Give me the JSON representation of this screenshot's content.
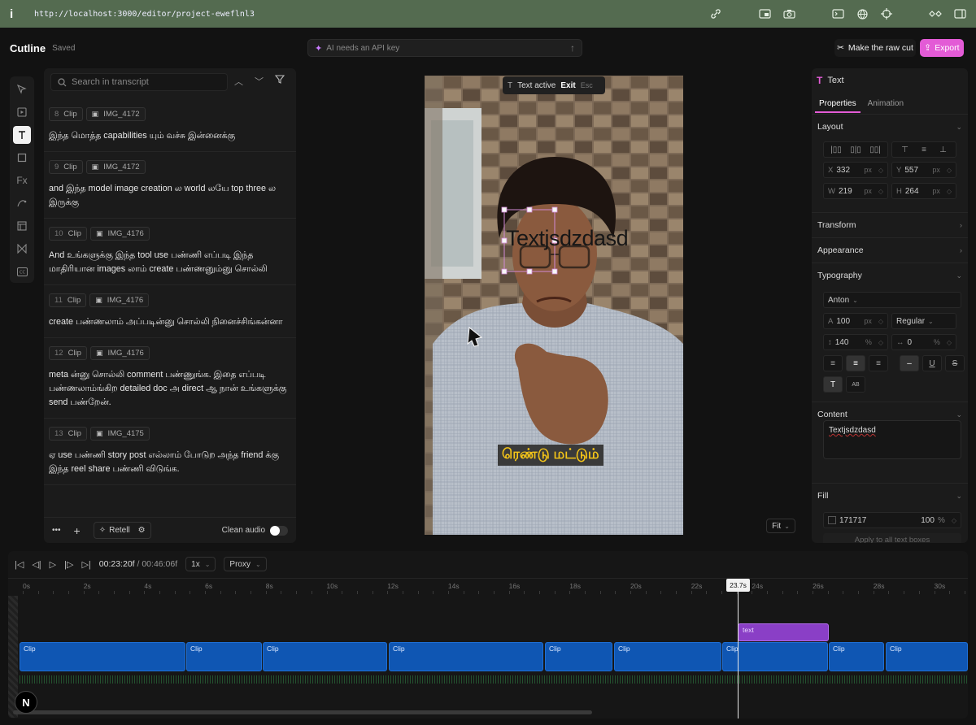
{
  "browser": {
    "url": "http://localhost:3000/editor/project-eweflnl3"
  },
  "app": {
    "name": "Cutline",
    "save_status": "Saved"
  },
  "ai_bar": {
    "placeholder": "AI needs an API key"
  },
  "header_actions": {
    "raw_cut_label": "Make the raw cut",
    "export_label": "Export"
  },
  "tools": [
    "select",
    "media",
    "text",
    "shape",
    "effects",
    "path",
    "layout",
    "transition",
    "captions"
  ],
  "transcript": {
    "search_placeholder": "Search in transcript",
    "segments": [
      {
        "index": "8",
        "type": "Clip",
        "source": "IMG_4172",
        "text": "இந்த மொத்த capabilities யும் வச்சு இன்னைக்கு"
      },
      {
        "index": "9",
        "type": "Clip",
        "source": "IMG_4172",
        "text": "and இந்த model image creation ல world லயே top three ல இருக்கு"
      },
      {
        "index": "10",
        "type": "Clip",
        "source": "IMG_4176",
        "text": "And உங்களுக்கு இந்த tool use பண்ணி எப்படி இந்த மாதிரியான images லாம் create பண்ணனும்னு சொல்லி"
      },
      {
        "index": "11",
        "type": "Clip",
        "source": "IMG_4176",
        "text": "create பண்ணலாம் அப்படின்னு சொல்லி நினைச்சிங்கன்னா"
      },
      {
        "index": "12",
        "type": "Clip",
        "source": "IMG_4176",
        "text": "meta ன்னு சொல்லி comment பண்ணுங்க. இதை எப்படி பண்ணலாம்ங்கிற detailed doc அ direct ஆ நான் உங்களுக்கு send பண்றேன்."
      },
      {
        "index": "13",
        "type": "Clip",
        "source": "IMG_4175",
        "text": "ஏ use பண்ணி story post எல்லாம் போடுற அந்த friend க்கு இந்த reel share பண்ணி விடுங்க."
      }
    ],
    "footer": {
      "retell_label": "Retell",
      "clean_audio_label": "Clean audio",
      "clean_audio_on": true
    }
  },
  "preview": {
    "text_active_label": "Text active",
    "exit_label": "Exit",
    "esc_label": "Esc",
    "overlay_text": "Textjsdzdasd",
    "caption": "ரெண்டு மட்டும்",
    "fit_label": "Fit"
  },
  "properties": {
    "title": "Text",
    "tabs": [
      "Properties",
      "Animation"
    ],
    "active_tab": "Properties",
    "layout_label": "Layout",
    "x": "332",
    "y": "557",
    "w": "219",
    "h": "264",
    "unit": "px",
    "transform_label": "Transform",
    "appearance_label": "Appearance",
    "typography_label": "Typography",
    "font": "Anton",
    "font_size": "100",
    "font_weight": "Regular",
    "line_height": "140",
    "letter_spacing": "0",
    "percent": "%",
    "content_label": "Content",
    "content_value": "Textjsdzdasd",
    "fill_label": "Fill",
    "fill_hex": "171717",
    "fill_opacity": "100",
    "apply_all_label": "Apply to all text boxes"
  },
  "timeline": {
    "current_time": "00:23:20f",
    "total_time": "00:46:06f",
    "speed": "1x",
    "proxy": "Proxy",
    "ticks": [
      "0s",
      "2s",
      "4s",
      "6s",
      "8s",
      "10s",
      "12s",
      "14s",
      "16s",
      "18s",
      "20s",
      "22s",
      "24s",
      "26s",
      "28s",
      "30s"
    ],
    "playhead_label": "23.7s",
    "text_clip_label": "text",
    "clip_label": "Clip",
    "clip_count": 9
  },
  "colors": {
    "accent": "#e35bd6",
    "video_clip": "#0f56b3",
    "text_clip": "#8a3fc6",
    "caption_highlight": "#f5c518"
  }
}
